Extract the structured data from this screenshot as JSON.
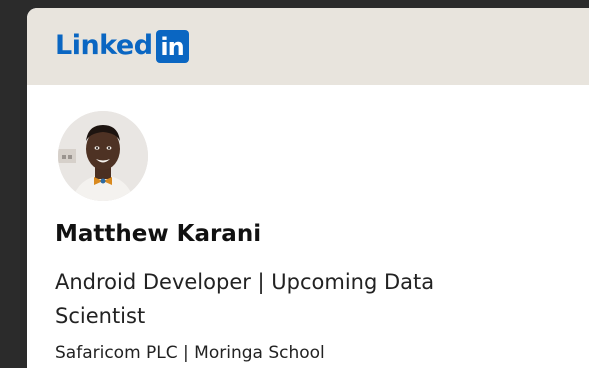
{
  "brand": {
    "wordmark": "Linked",
    "badge": "in",
    "color": "#0a66c2"
  },
  "profile": {
    "name": "Matthew Karani",
    "headline": "Android Developer | Upcoming Data Scientist",
    "organizations": "Safaricom PLC | Moringa School",
    "avatar_icon": "profile-photo"
  },
  "colors": {
    "header_background": "#e8e4dd",
    "card_background": "#ffffff",
    "page_background": "#2b2b2b"
  }
}
